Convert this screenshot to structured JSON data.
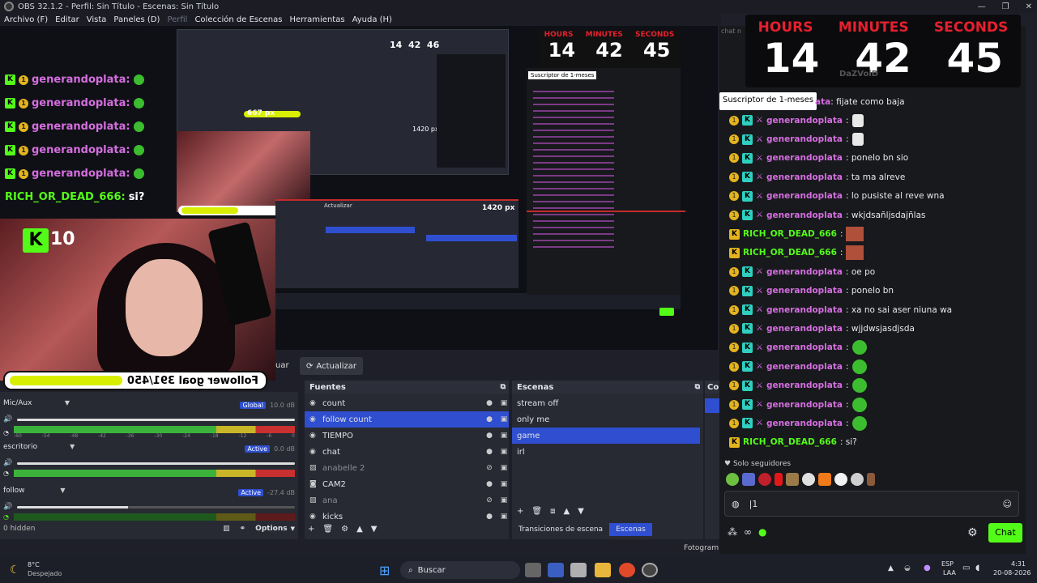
{
  "window": {
    "title": "OBS 32.1.2 - Perfil: Sin Título - Escenas: Sin Título",
    "controls": [
      "—",
      "❐",
      "✕"
    ]
  },
  "menu": [
    {
      "label": "Archivo (F)",
      "enabled": true
    },
    {
      "label": "Editar",
      "enabled": true
    },
    {
      "label": "Vista",
      "enabled": true
    },
    {
      "label": "Paneles (D)",
      "enabled": true
    },
    {
      "label": "Perfil",
      "enabled": false
    },
    {
      "label": "Colección de Escenas",
      "enabled": true
    },
    {
      "label": "Herramientas",
      "enabled": true
    },
    {
      "label": "Ayuda (H)",
      "enabled": true
    }
  ],
  "overlay": {
    "chat_lines": [
      {
        "user": "generandoplata:",
        "color": "#d56ee0"
      },
      {
        "user": "generandoplata:",
        "color": "#d56ee0"
      },
      {
        "user": "generandoplata:",
        "color": "#d56ee0"
      },
      {
        "user": "generandoplata:",
        "color": "#d56ee0"
      },
      {
        "user": "generandoplata:",
        "color": "#d56ee0"
      },
      {
        "user": "RICH_OR_DEAD_666:",
        "msg": "si?",
        "color": "#53fc18"
      }
    ],
    "k_count": "10",
    "goal_text": "Follower goal 391/450",
    "goal_fraction": 0.87,
    "timer": {
      "hours_label": "HOURS",
      "minutes_label": "MINUTES",
      "seconds_label": "SECONDS",
      "hours": "14",
      "minutes": "42",
      "seconds": "45"
    },
    "nested_labels": {
      "px1": "667 px",
      "px2": "1420 px",
      "update": "Actualizar"
    }
  },
  "controls_bar": {
    "update_label": "Actualizar",
    "uar_label": "uar"
  },
  "audio_mixer": {
    "channels": [
      {
        "name": "Mic/Aux",
        "tag": "Global",
        "db": "10.0 dB",
        "level": 0.98
      },
      {
        "name": "escritorio",
        "tag": "Active",
        "db": "0.0 dB",
        "level": 0.98
      },
      {
        "name": "follow",
        "tag": "Active",
        "db": "-27.4 dB",
        "level": 0.4
      }
    ],
    "scale": [
      "-60",
      "-54",
      "-48",
      "-42",
      "-36",
      "-30",
      "-24",
      "-18",
      "-12",
      "-6",
      "0"
    ],
    "hidden_label": "0 hidden",
    "options_label": "Options"
  },
  "sources": {
    "title": "Fuentes",
    "items": [
      {
        "name": "count",
        "visible": true,
        "selected": false
      },
      {
        "name": "follow count",
        "visible": true,
        "selected": true
      },
      {
        "name": "TIEMPO",
        "visible": true,
        "selected": false
      },
      {
        "name": "chat",
        "visible": true,
        "selected": false
      },
      {
        "name": "anabelle 2",
        "visible": false,
        "selected": false
      },
      {
        "name": "CAM2",
        "visible": true,
        "selected": false
      },
      {
        "name": "ana",
        "visible": false,
        "selected": false
      },
      {
        "name": "kicks",
        "visible": true,
        "selected": false
      }
    ]
  },
  "scenes": {
    "title": "Escenas",
    "items": [
      {
        "name": "stream off",
        "selected": false
      },
      {
        "name": "only me",
        "selected": false
      },
      {
        "name": "game",
        "selected": true
      },
      {
        "name": "irl",
        "selected": false
      }
    ],
    "tabs": [
      {
        "label": "Transiciones de escena",
        "active": false
      },
      {
        "label": "Escenas",
        "active": true
      }
    ]
  },
  "controls_dock": {
    "title": "Co"
  },
  "chat_panel": {
    "header": "chat n",
    "tooltip": "Suscriptor de 1-meses",
    "first_msg": {
      "user": "ata",
      "msg": ": fijate como baja"
    },
    "watermark": "DaZVoiD",
    "messages": [
      {
        "user": "generandoplata",
        "msg": ":",
        "k": false,
        "emote": "hand"
      },
      {
        "user": "generandoplata",
        "msg": ":",
        "k": false,
        "emote": "hand"
      },
      {
        "user": "generandoplata",
        "msg": ": ponelo bn sio",
        "k": false
      },
      {
        "user": "generandoplata",
        "msg": ": ta ma alreve",
        "k": false
      },
      {
        "user": "generandoplata",
        "msg": ": lo pusiste al reve wna",
        "k": false
      },
      {
        "user": "generandoplata",
        "msg": ": wkjdsañljsdajñlas",
        "k": false
      },
      {
        "user": "RICH_OR_DEAD_666",
        "msg": ":",
        "k": true,
        "emote": "face"
      },
      {
        "user": "RICH_OR_DEAD_666",
        "msg": ":",
        "k": true,
        "emote": "face"
      },
      {
        "user": "generandoplata",
        "msg": ": oe po",
        "k": false
      },
      {
        "user": "generandoplata",
        "msg": ": ponelo bn",
        "k": false
      },
      {
        "user": "generandoplata",
        "msg": ": xa no sai aser niuna wa",
        "k": false
      },
      {
        "user": "generandoplata",
        "msg": ": wjjdwsjasdjsda",
        "k": false
      },
      {
        "user": "generandoplata",
        "msg": ":",
        "k": false,
        "emote": "green"
      },
      {
        "user": "generandoplata",
        "msg": ":",
        "k": false,
        "emote": "green"
      },
      {
        "user": "generandoplata",
        "msg": ":",
        "k": false,
        "emote": "green"
      },
      {
        "user": "generandoplata",
        "msg": ":",
        "k": false,
        "emote": "green"
      },
      {
        "user": "generandoplata",
        "msg": ":",
        "k": false,
        "emote": "green"
      },
      {
        "user": "RICH_OR_DEAD_666",
        "msg": ": si?",
        "k": true
      }
    ],
    "followers_only": "Solo seguidores",
    "input_value": "|1",
    "send_label": "Chat"
  },
  "status_bar": {
    "fotograma": "Fotogram"
  },
  "taskbar": {
    "weather_temp": "8°C",
    "weather_desc": "Despejado",
    "search_placeholder": "Buscar",
    "lang_top": "ESP",
    "lang_bottom": "LAA",
    "time": "4:31",
    "date": "20-08-2026"
  },
  "colors": {
    "accent": "#2f4fd0",
    "kick_green": "#53fc18",
    "chat_pink": "#d56ee0",
    "timer_red": "#e5202e"
  }
}
